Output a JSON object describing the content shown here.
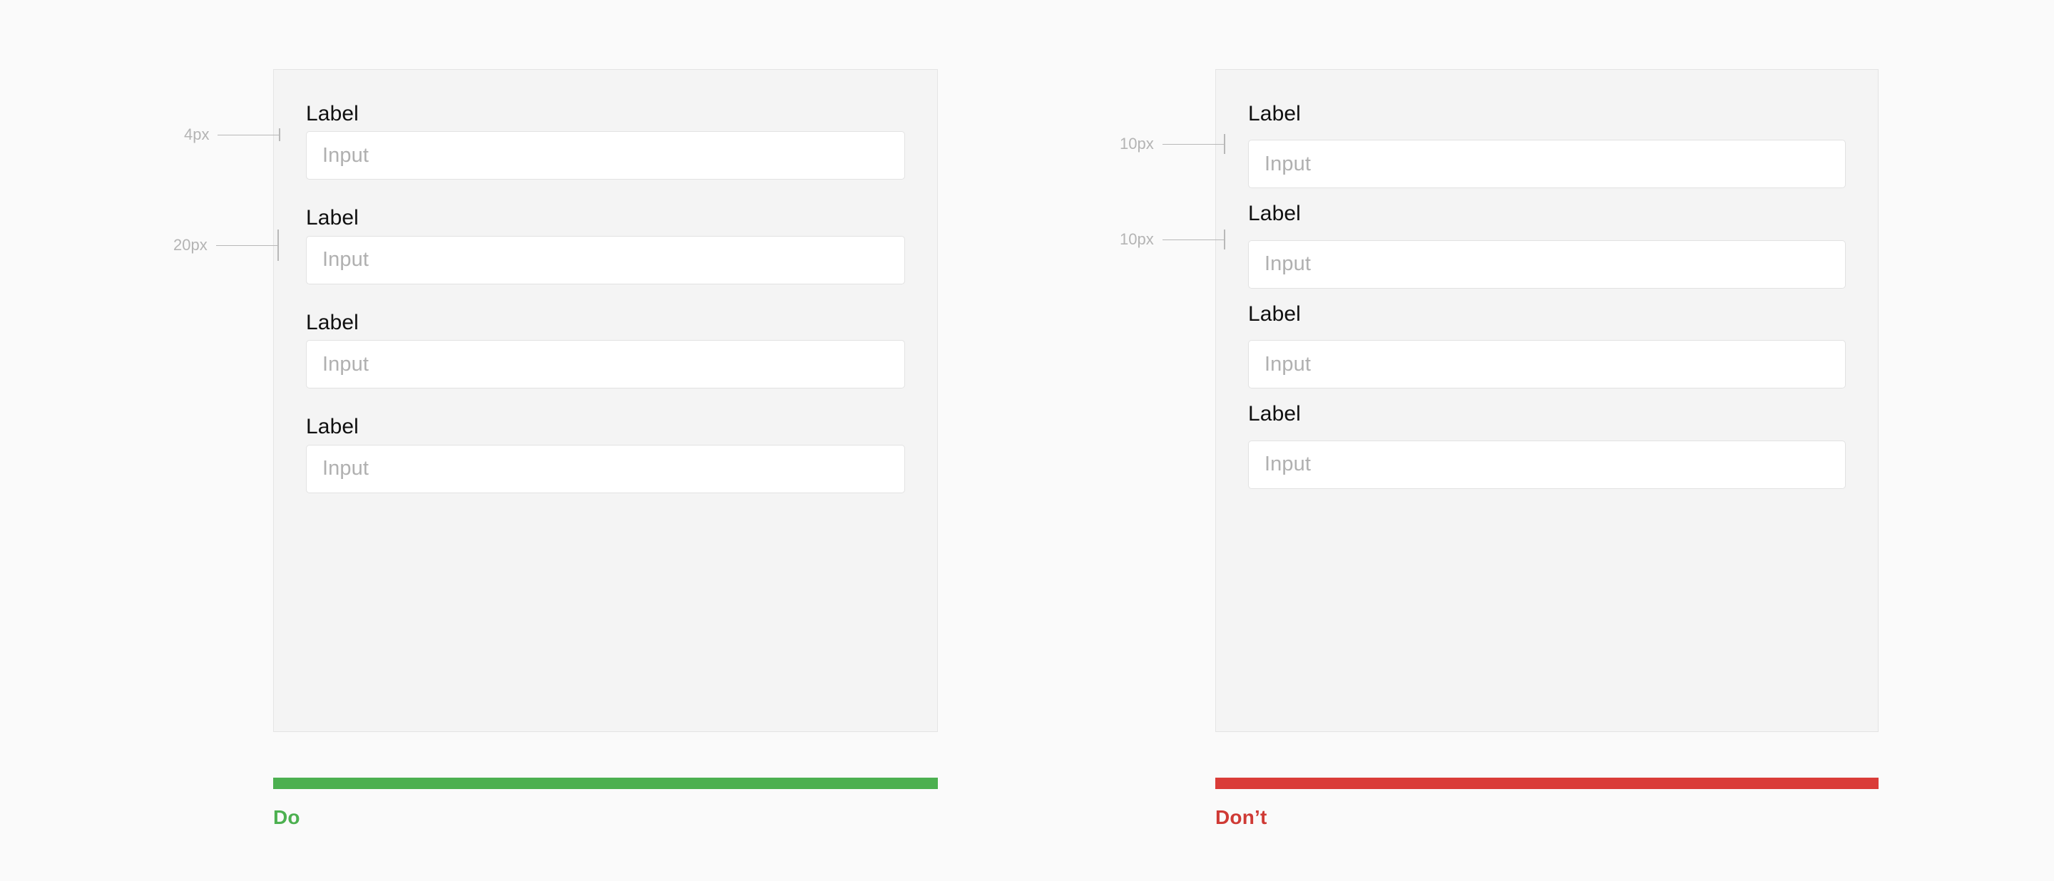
{
  "page": {
    "background_color": "#fafafa"
  },
  "examples": [
    {
      "key": "do",
      "verdict_label": "Do",
      "accent_color": "#4cb050",
      "card_background": "#f4f4f4",
      "fields": [
        {
          "label": "Label",
          "placeholder": "Input",
          "value": ""
        },
        {
          "label": "Label",
          "placeholder": "Input",
          "value": ""
        },
        {
          "label": "Label",
          "placeholder": "Input",
          "value": ""
        },
        {
          "label": "Label",
          "placeholder": "Input",
          "value": ""
        }
      ],
      "annotations": [
        {
          "key": "label-to-input-gap",
          "text": "4px"
        },
        {
          "key": "group-to-group-gap",
          "text": "20px"
        }
      ]
    },
    {
      "key": "dont",
      "verdict_label": "Don’t",
      "accent_color": "#da3c38",
      "card_background": "#f4f4f4",
      "fields": [
        {
          "label": "Label",
          "placeholder": "Input",
          "value": ""
        },
        {
          "label": "Label",
          "placeholder": "Input",
          "value": ""
        },
        {
          "label": "Label",
          "placeholder": "Input",
          "value": ""
        },
        {
          "label": "Label",
          "placeholder": "Input",
          "value": ""
        }
      ],
      "annotations": [
        {
          "key": "label-to-input-gap",
          "text": "10px"
        },
        {
          "key": "group-to-group-gap",
          "text": "10px"
        }
      ]
    }
  ]
}
